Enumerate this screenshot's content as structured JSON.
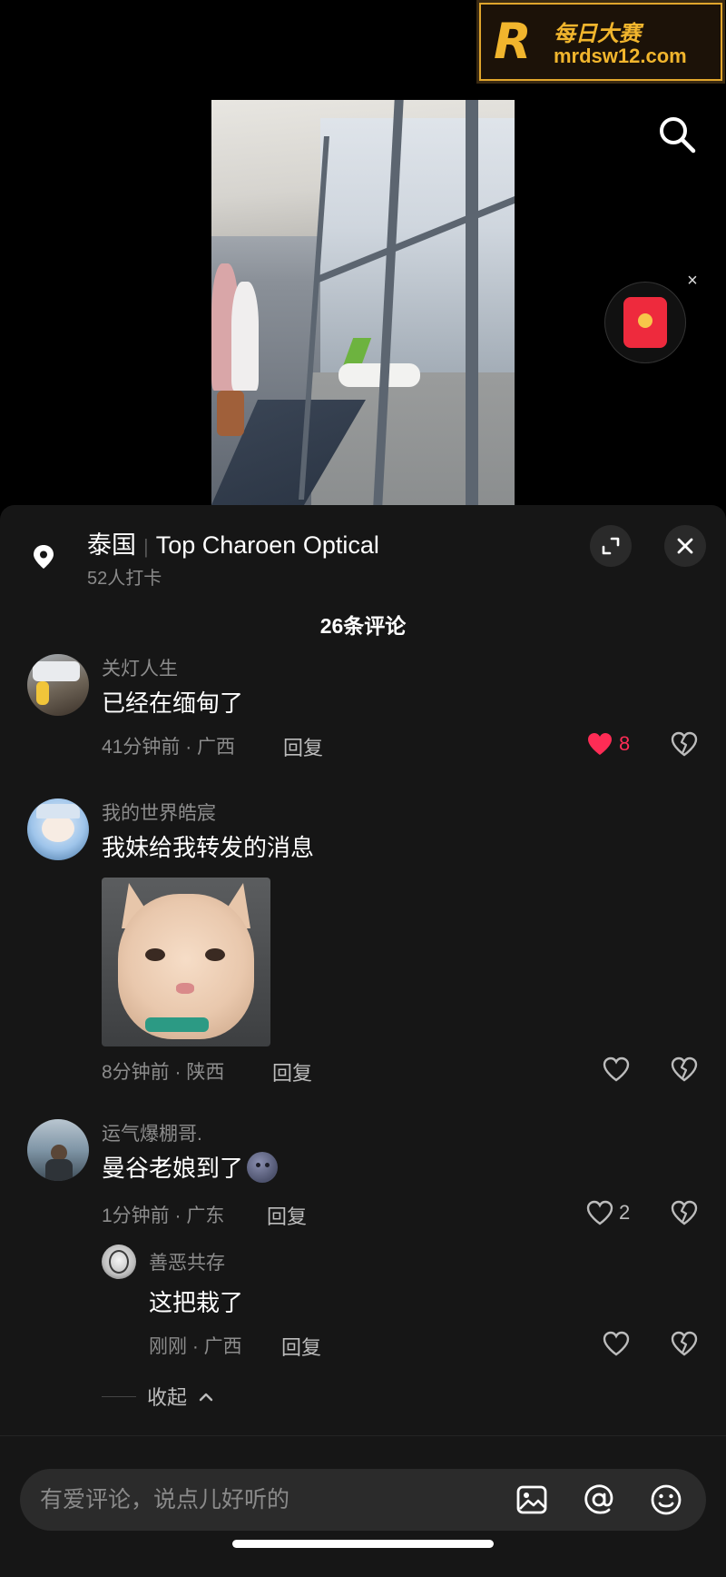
{
  "watermark": {
    "logo": "R",
    "title": "每日大赛",
    "url": "mrdsw12.com"
  },
  "video": {
    "search_label": "搜索"
  },
  "location": {
    "country": "泰国",
    "place": "Top Charoen Optical",
    "checkins": "52人打卡"
  },
  "comments_header": "26条评论",
  "comments": [
    {
      "name": "关灯人生",
      "text": "已经在缅甸了",
      "time": "41分钟前 · 广西",
      "reply": "回复",
      "likes": "8",
      "liked": true
    },
    {
      "name": "我的世界皓宸",
      "text": "我妹给我转发的消息",
      "time": "8分钟前 · 陕西",
      "reply": "回复",
      "likes": "",
      "liked": false
    },
    {
      "name": "运气爆棚哥.",
      "text": "曼谷老娘到了",
      "time": "1分钟前 · 广东",
      "reply": "回复",
      "likes": "2",
      "liked": false
    }
  ],
  "reply": {
    "name": "善恶共存",
    "text": "这把栽了",
    "time": "刚刚 · 广西",
    "reply": "回复"
  },
  "collapse_label": "收起",
  "input": {
    "placeholder": "有爱评论，说点儿好听的"
  },
  "colors": {
    "sheet_bg": "#161616",
    "like_red": "#fe2c55",
    "text_muted": "#8c8c8c"
  }
}
